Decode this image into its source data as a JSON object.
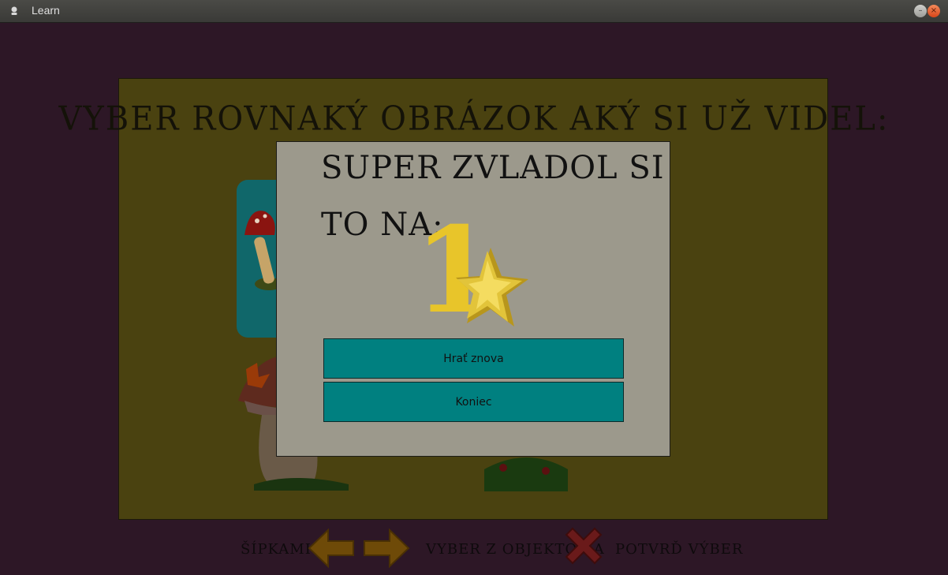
{
  "window": {
    "title": "Learn",
    "minimize_glyph": "–",
    "close_glyph": "×"
  },
  "game": {
    "instruction": "VYBER ROVNAKÝ OBRÁZOK AKÝ SI UŽ VIDEL:",
    "icons": [
      "fly-agaric-mushroom",
      "porcini-mushroom",
      "flowers-mushroom"
    ]
  },
  "dialog": {
    "line1": "SUPER ZVLADOL SI",
    "line2": "TO NA:",
    "score": "1",
    "star_icon": "gold-star",
    "play_again_label": "Hrať znova",
    "quit_label": "Koniec"
  },
  "footer": {
    "arrows_label": "ŠÍPKAMI",
    "choose_label": "VYBER Z OBJEKTOV A",
    "confirm_label": "POTVRĎ VÝBER",
    "icons": [
      "arrow-left-icon",
      "arrow-right-icon",
      "x-mark-icon"
    ]
  },
  "colors": {
    "background": "#2d1726",
    "board": "#4a4210",
    "dialog": "#9c998c",
    "button": "#008080",
    "score": "#e8c52a",
    "selection": "#10676a"
  }
}
